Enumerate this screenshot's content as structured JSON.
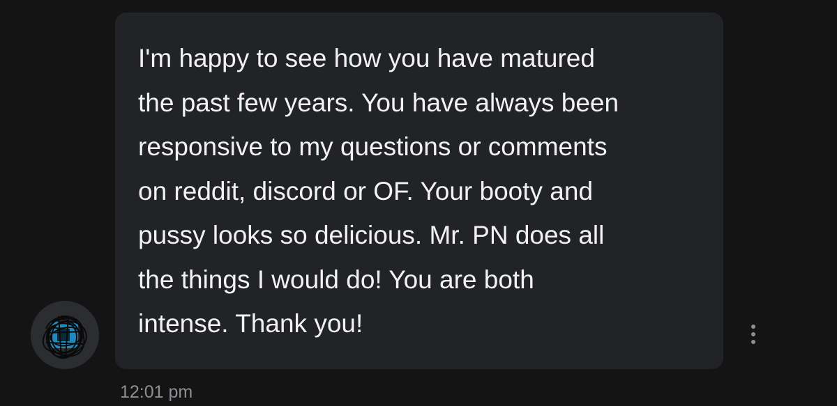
{
  "conversation": {
    "message": {
      "text": "I'm happy to see how you have matured\nthe past few years. You have always been\nresponsive to my questions or comments\non reddit, discord or OF. Your booty and\npussy looks so delicious. Mr. PN does all\nthe things I would do! You are both\nintense. Thank you!",
      "timestamp": "12:01 pm"
    },
    "sender_avatar": {
      "icon": "scribbled-avatar-icon",
      "accent_color": "#1e9bd6"
    },
    "more_options": {
      "icon": "vertical-ellipsis-icon"
    }
  },
  "colors": {
    "background": "#141414",
    "bubble": "#212326",
    "text": "#f2f2f2",
    "muted": "#8c8f94"
  }
}
